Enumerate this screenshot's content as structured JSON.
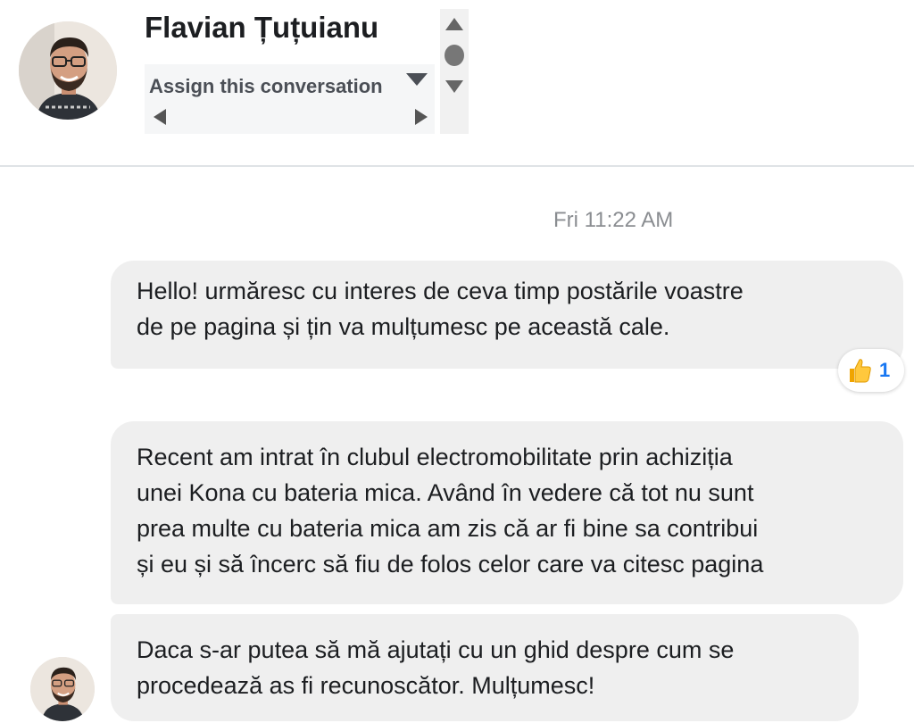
{
  "header": {
    "contact_name": "Flavian Țuțuianu",
    "assign_label": "Assign this conversation"
  },
  "thread": {
    "timestamp": "Fri 11:22 AM",
    "messages": [
      {
        "lines": [
          "Hello! urmăresc cu interes de ceva timp postările voastre",
          "de pe pagina și țin va mulțumesc pe această cale."
        ],
        "reaction": {
          "icon": "thumbs-up-icon",
          "count": "1"
        }
      },
      {
        "lines": [
          "Recent am intrat în clubul electromobilitate prin achiziția",
          "unei Kona cu bateria mica. Având în vedere că tot nu sunt",
          "prea multe cu bateria mica am zis că ar fi bine sa contribui",
          "și eu și să încerc să fiu de folos celor care va citesc pagina"
        ]
      },
      {
        "lines": [
          "Daca s-ar putea să mă ajutați cu un ghid despre cum se",
          "procedează as fi recunoscător. Mulțumesc!"
        ]
      }
    ]
  },
  "colors": {
    "bubble": "#efefef",
    "reaction_count": "#1877f2",
    "timestamp": "#8a8d91"
  }
}
